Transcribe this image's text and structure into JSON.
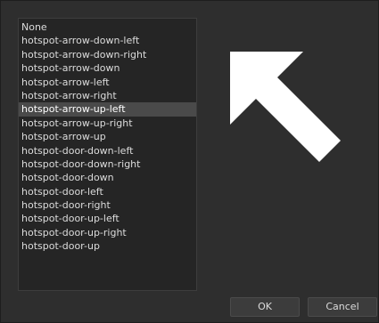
{
  "list": {
    "items": [
      {
        "label": "None",
        "selected": false
      },
      {
        "label": "hotspot-arrow-down-left",
        "selected": false
      },
      {
        "label": "hotspot-arrow-down-right",
        "selected": false
      },
      {
        "label": "hotspot-arrow-down",
        "selected": false
      },
      {
        "label": "hotspot-arrow-left",
        "selected": false
      },
      {
        "label": "hotspot-arrow-right",
        "selected": false
      },
      {
        "label": "hotspot-arrow-up-left",
        "selected": true
      },
      {
        "label": "hotspot-arrow-up-right",
        "selected": false
      },
      {
        "label": "hotspot-arrow-up",
        "selected": false
      },
      {
        "label": "hotspot-door-down-left",
        "selected": false
      },
      {
        "label": "hotspot-door-down-right",
        "selected": false
      },
      {
        "label": "hotspot-door-down",
        "selected": false
      },
      {
        "label": "hotspot-door-left",
        "selected": false
      },
      {
        "label": "hotspot-door-right",
        "selected": false
      },
      {
        "label": "hotspot-door-up-left",
        "selected": false
      },
      {
        "label": "hotspot-door-up-right",
        "selected": false
      },
      {
        "label": "hotspot-door-up",
        "selected": false
      }
    ]
  },
  "preview": {
    "icon": "arrow-up-left-icon",
    "color": "#ffffff"
  },
  "buttons": {
    "ok_label": "OK",
    "cancel_label": "Cancel"
  },
  "colors": {
    "background": "#2e2e2e",
    "list_background": "#252525",
    "selection": "#4a4a4a",
    "text": "#dcdcdc"
  }
}
